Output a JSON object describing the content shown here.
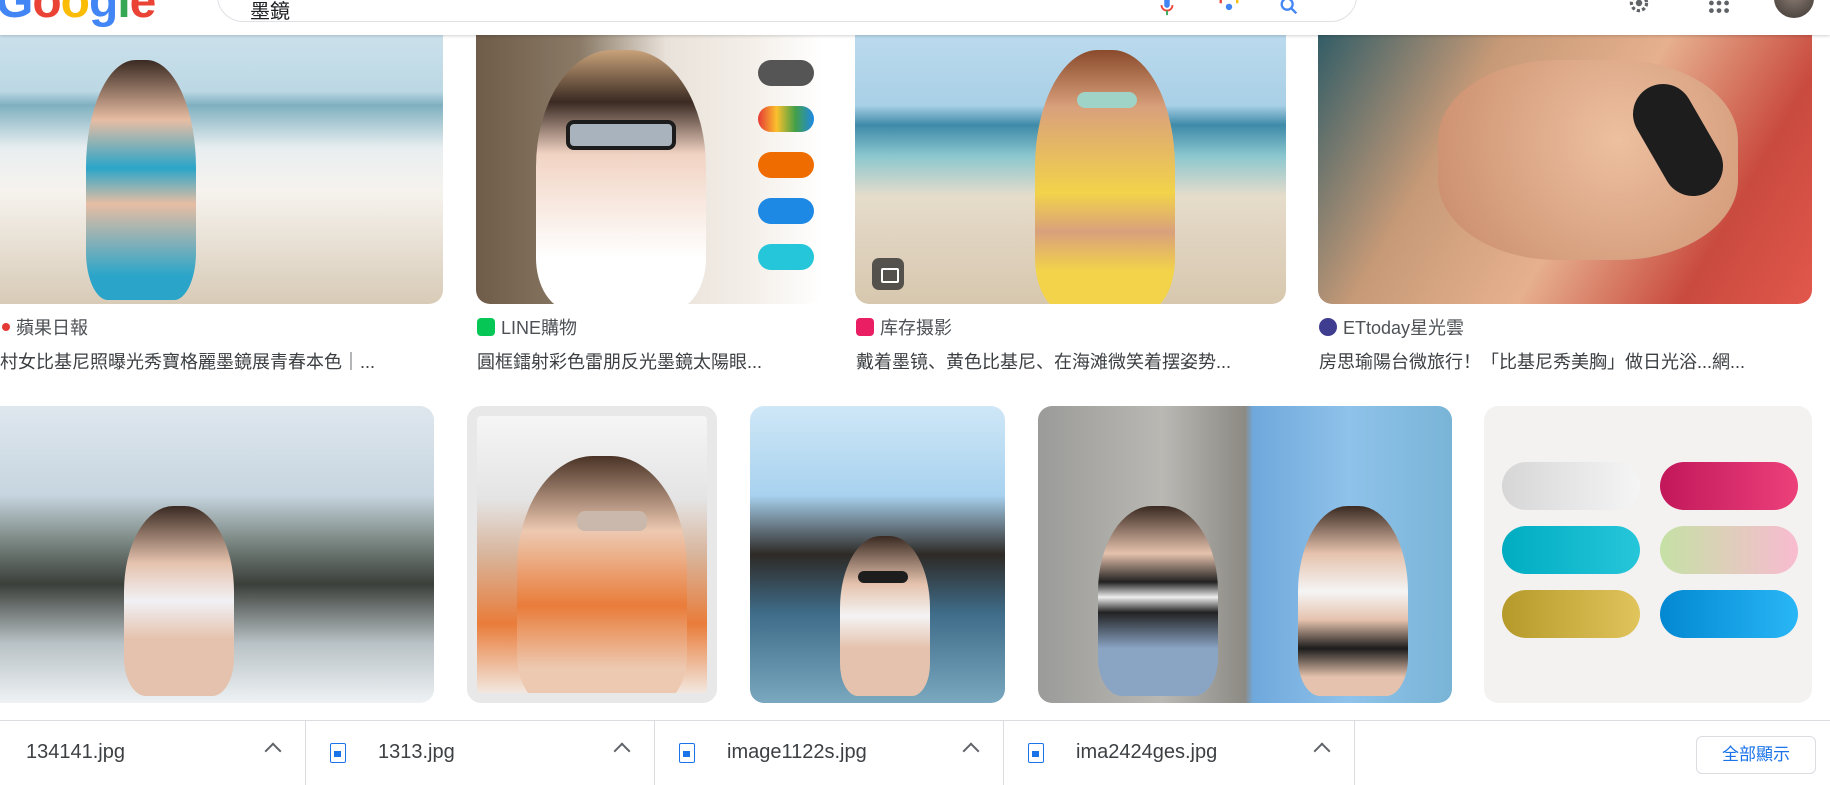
{
  "header": {
    "logo_letters": [
      "G",
      "o",
      "o",
      "g",
      "l",
      "e"
    ],
    "search_query": "墨鏡"
  },
  "results_row1": [
    {
      "source": "蘋果日報",
      "title": "村女比基尼照曝光秀寶格麗墨鏡展青春本色｜...",
      "source_icon_color": "#e53935"
    },
    {
      "source": "LINE購物",
      "title": "圓框鐳射彩色雷朋反光墨鏡太陽眼...",
      "source_icon_color": "#06c755"
    },
    {
      "source": "库存摄影",
      "title": "戴着墨镜、黄色比基尼、在海滩微笑着摆姿势...",
      "source_icon_color": "#e91e63"
    },
    {
      "source": "ETtoday星光雲",
      "title": "房思瑜陽台微旅行！「比基尼秀美胸」做日光浴...網...",
      "source_icon_color": "#3f3d8f"
    }
  ],
  "downloads": [
    {
      "filename": "134141.jpg"
    },
    {
      "filename": "1313.jpg"
    },
    {
      "filename": "image1122s.jpg"
    },
    {
      "filename": "ima2424ges.jpg"
    }
  ],
  "show_all_label": "全部顯示",
  "colors": {
    "link_blue": "#1a73e8",
    "text_gray": "#4d5156"
  }
}
